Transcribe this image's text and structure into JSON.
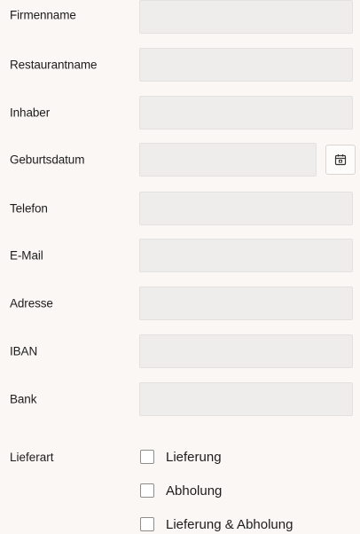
{
  "fields": {
    "firmenname": {
      "label": "Firmenname",
      "value": ""
    },
    "restaurantname": {
      "label": "Restaurantname",
      "value": ""
    },
    "inhaber": {
      "label": "Inhaber",
      "value": ""
    },
    "geburtsdatum": {
      "label": "Geburtsdatum",
      "value": "",
      "icon": "calendar-icon"
    },
    "telefon": {
      "label": "Telefon",
      "value": ""
    },
    "email": {
      "label": "E-Mail",
      "value": ""
    },
    "adresse": {
      "label": "Adresse",
      "value": ""
    },
    "iban": {
      "label": "IBAN",
      "value": ""
    },
    "bank": {
      "label": "Bank",
      "value": ""
    }
  },
  "lieferart": {
    "label": "Lieferart",
    "options": [
      {
        "label": "Lieferung",
        "checked": false
      },
      {
        "label": "Abholung",
        "checked": false
      },
      {
        "label": "Lieferung & Abholung",
        "checked": false
      }
    ]
  },
  "colors": {
    "background": "#faf7f4",
    "input_background": "#eeedec",
    "text": "#1d1d1d"
  }
}
